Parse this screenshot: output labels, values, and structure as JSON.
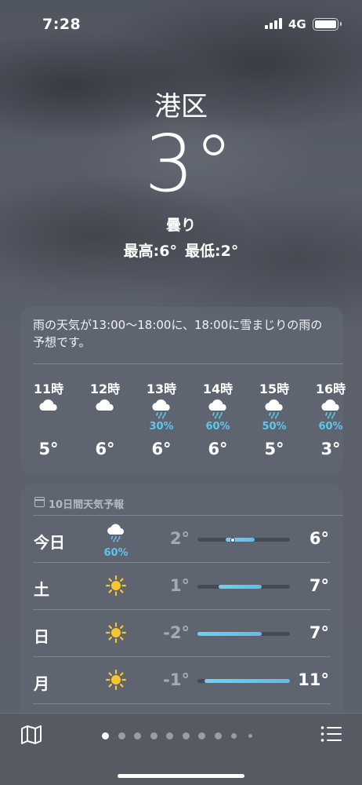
{
  "status_bar": {
    "time": "7:28",
    "network": "4G"
  },
  "current": {
    "location": "港区",
    "temperature": "3°",
    "condition": "曇り",
    "high": "最高:6°",
    "low": "最低:2°"
  },
  "hourly": {
    "summary": "雨の天気が13:00～18:00に、18:00に雪まじりの雨の予想です。",
    "items": [
      {
        "time": "11時",
        "icon": "cloud-icon",
        "pop": "",
        "temp": "5°"
      },
      {
        "time": "12時",
        "icon": "cloud-icon",
        "pop": "",
        "temp": "6°"
      },
      {
        "time": "13時",
        "icon": "rain-cloud-icon",
        "pop": "30%",
        "temp": "6°"
      },
      {
        "time": "14時",
        "icon": "rain-cloud-icon",
        "pop": "60%",
        "temp": "6°"
      },
      {
        "time": "15時",
        "icon": "rain-cloud-icon",
        "pop": "50%",
        "temp": "5°"
      },
      {
        "time": "16時",
        "icon": "rain-cloud-icon",
        "pop": "60%",
        "temp": "3°"
      }
    ]
  },
  "daily": {
    "title": "10日間天気予報",
    "scale_min": -2,
    "scale_max": 11,
    "items": [
      {
        "day": "今日",
        "icon": "rain-cloud-icon",
        "pop": "60%",
        "low": "2°",
        "high": "6°",
        "low_value": 2,
        "high_value": 6,
        "current_value": 3
      },
      {
        "day": "土",
        "icon": "sun-icon",
        "pop": "",
        "low": "1°",
        "high": "7°",
        "low_value": 1,
        "high_value": 7
      },
      {
        "day": "日",
        "icon": "sun-icon",
        "pop": "",
        "low": "-2°",
        "high": "7°",
        "low_value": -2,
        "high_value": 7
      },
      {
        "day": "月",
        "icon": "sun-icon",
        "pop": "",
        "low": "-1°",
        "high": "11°",
        "low_value": -1,
        "high_value": 11
      }
    ]
  },
  "bottom_bar": {
    "page_count": 10,
    "active_page": 0,
    "map_icon": "map-icon",
    "list_icon": "list-icon"
  },
  "colors": {
    "precipitation": "#5fc6ee",
    "temp_bar": "#6cd3f3"
  }
}
